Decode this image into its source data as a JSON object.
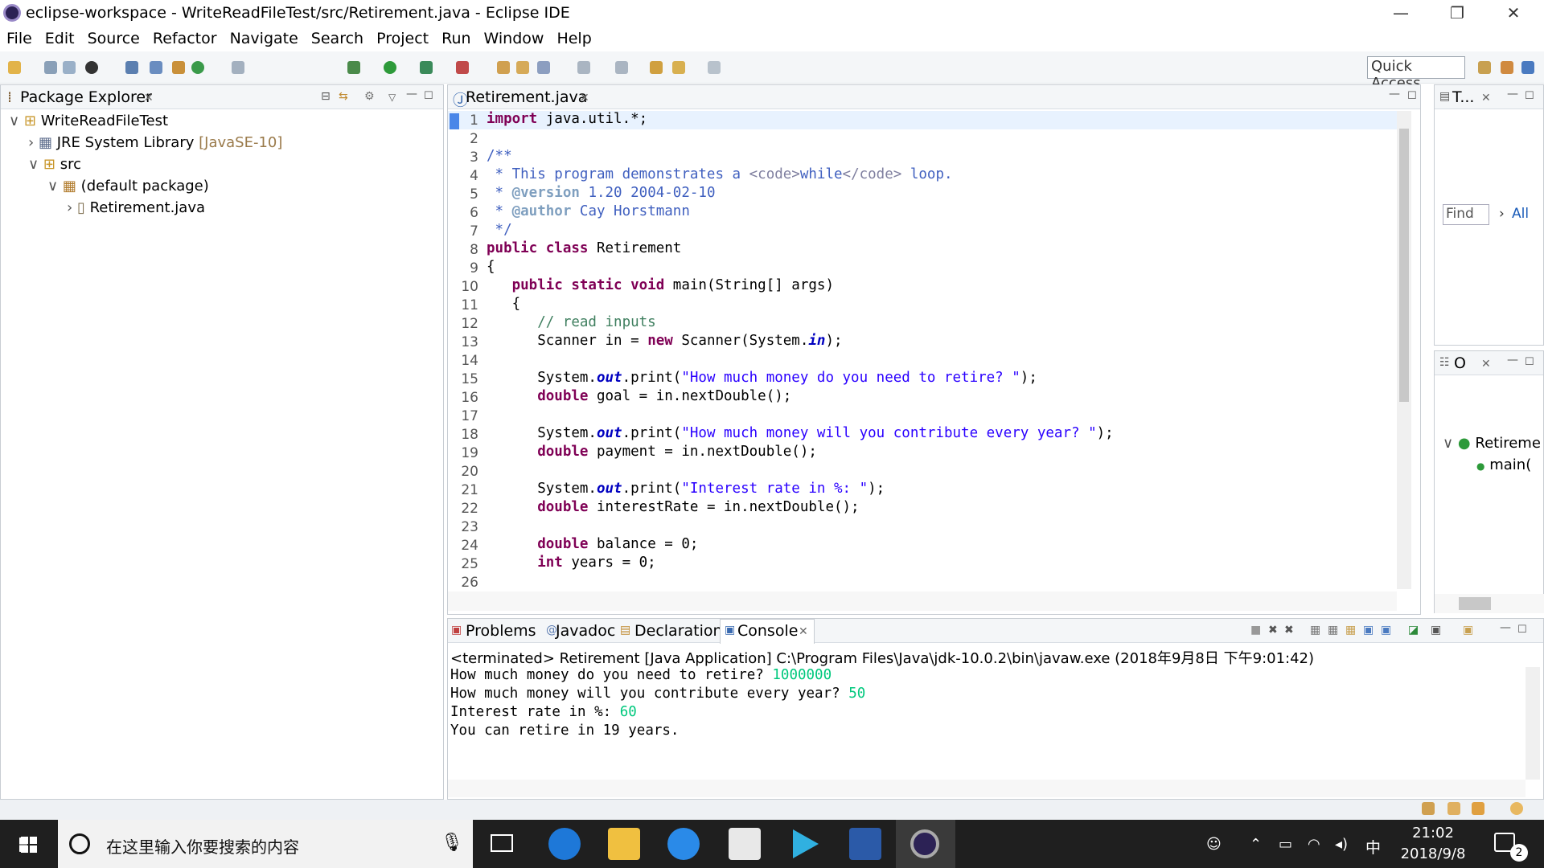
{
  "window": {
    "title": "eclipse-workspace - WriteReadFileTest/src/Retirement.java - Eclipse IDE",
    "minimize": "—",
    "restore": "❐",
    "close": "✕"
  },
  "menu": [
    "File",
    "Edit",
    "Source",
    "Refactor",
    "Navigate",
    "Search",
    "Project",
    "Run",
    "Window",
    "Help"
  ],
  "toolbar": {
    "quick_access": "Quick Access"
  },
  "package_explorer": {
    "tab": "Package Explorer",
    "project": "WriteReadFileTest",
    "jre": "JRE System Library",
    "jre_version": "[JavaSE-10]",
    "src": "src",
    "package": "(default package)",
    "file": "Retirement.java"
  },
  "editor": {
    "tab": "Retirement.java",
    "lines": [
      "1",
      "2",
      "3",
      "4",
      "5",
      "6",
      "7",
      "8",
      "9",
      "10",
      "11",
      "12",
      "13",
      "14",
      "15",
      "16",
      "17",
      "18",
      "19",
      "20",
      "21",
      "22",
      "23",
      "24",
      "25",
      "26"
    ],
    "l1a": "import",
    "l1b": " java.util.*;",
    "l3": "/**",
    "l4a": " * This program demonstrates a ",
    "l4b": "<code>",
    "l4c": "while",
    "l4d": "</code>",
    "l4e": " loop.",
    "l5a": " * ",
    "l5b": "@version",
    "l5c": " 1.20 2004-02-10",
    "l6a": " * ",
    "l6b": "@author",
    "l6c": " Cay Horstmann",
    "l7": " */",
    "l8a": "public class",
    "l8b": " Retirement",
    "l9": "{",
    "l10a": "   public static void",
    "l10b": " main(String[] args)",
    "l11": "   {",
    "l12": "      // read inputs",
    "l13a": "      Scanner in = ",
    "l13b": "new",
    "l13c": " Scanner(System.",
    "l13d": "in",
    "l13e": ");",
    "l15a": "      System.",
    "l15b": "out",
    "l15c": ".print(",
    "l15d": "\"How much money do you need to retire? \"",
    "l15e": ");",
    "l16a": "      ",
    "l16b": "double",
    "l16c": " goal = in.nextDouble();",
    "l18a": "      System.",
    "l18b": "out",
    "l18c": ".print(",
    "l18d": "\"How much money will you contribute every year? \"",
    "l18e": ");",
    "l19a": "      ",
    "l19b": "double",
    "l19c": " payment = in.nextDouble();",
    "l21a": "      System.",
    "l21b": "out",
    "l21c": ".print(",
    "l21d": "\"Interest rate in %: \"",
    "l21e": ");",
    "l22a": "      ",
    "l22b": "double",
    "l22c": " interestRate = in.nextDouble();",
    "l24a": "      ",
    "l24b": "double",
    "l24c": " balance = 0;",
    "l25a": "      ",
    "l25b": "int",
    "l25c": " years = 0;"
  },
  "console": {
    "tabs": {
      "problems": "Problems",
      "javadoc": "Javadoc",
      "declaration": "Declaration",
      "console": "Console"
    },
    "status": "<terminated> Retirement [Java Application] C:\\Program Files\\Java\\jdk-10.0.2\\bin\\javaw.exe (2018年9月8日 下午9:01:42)",
    "q1": "How much money do you need to retire? ",
    "a1": "1000000",
    "q2": "How much money will you contribute every year? ",
    "a2": "50",
    "q3": "Interest rate in %: ",
    "a3": "60",
    "out": "You can retire in 19 years."
  },
  "right_panel": {
    "tab": "T...",
    "find": "Find",
    "all": "All",
    "outline_tab": "O",
    "class_name": "Retireme",
    "method": "main("
  },
  "taskbar": {
    "search_placeholder": "在这里输入你要搜索的内容",
    "time": "21:02",
    "date": "2018/9/8",
    "ime": "中",
    "notif": "2"
  }
}
